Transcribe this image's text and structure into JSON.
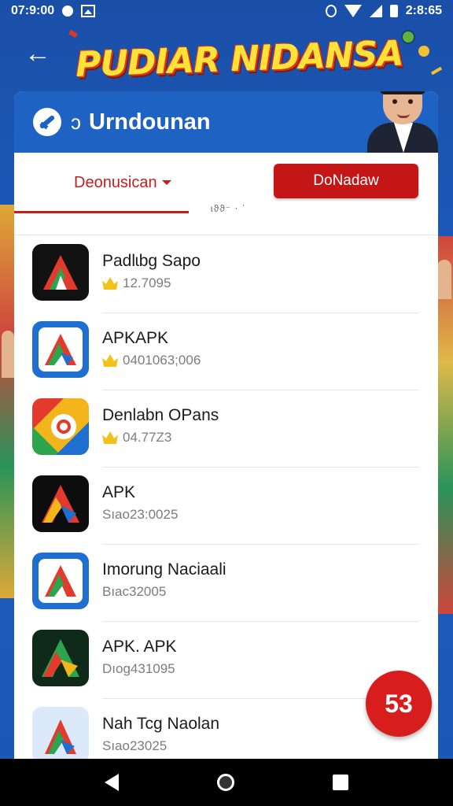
{
  "status_bar": {
    "time": "07:9:00",
    "clock_right": "2:8:65"
  },
  "banner": {
    "title": "PUDIAR NIDANSA"
  },
  "header": {
    "prefix": "ↄ",
    "title": "Urndounan"
  },
  "tabs": {
    "primary_label": "Deonusican",
    "secondary_label": "ɩϑϑ⁻ ⋅ ˈ"
  },
  "download_button": {
    "label": "DoNadaw"
  },
  "apps": [
    {
      "name": "Padlɩbg Sapo",
      "meta": "12.7095",
      "icon": "dark-a-icon",
      "crown": true
    },
    {
      "name": "APKAPK",
      "meta": "0401063;006",
      "icon": "blue-a-icon",
      "crown": true
    },
    {
      "name": "Denlabn OPans",
      "meta": "04.77Z3",
      "icon": "colorful-a-icon",
      "crown": true
    },
    {
      "name": "APK",
      "meta": "Sıao23:0025",
      "icon": "dark-gold-a-icon",
      "crown": false
    },
    {
      "name": "Imorung Naciaali",
      "meta": "Bıac32005",
      "icon": "blue-a-icon",
      "crown": false
    },
    {
      "name": "APK. APK",
      "meta": "Dıog431095",
      "icon": "dark-green-a-icon",
      "crown": false
    },
    {
      "name": "Nah Tcg Naolan",
      "meta": "Sıao23025",
      "icon": "light-blue-a-icon",
      "crown": false
    }
  ],
  "fab": {
    "label": "53"
  },
  "colors": {
    "background": "#1d5cbd",
    "header": "#1e63c4",
    "accent_red": "#c41616",
    "banner_yellow": "#fde23a"
  }
}
